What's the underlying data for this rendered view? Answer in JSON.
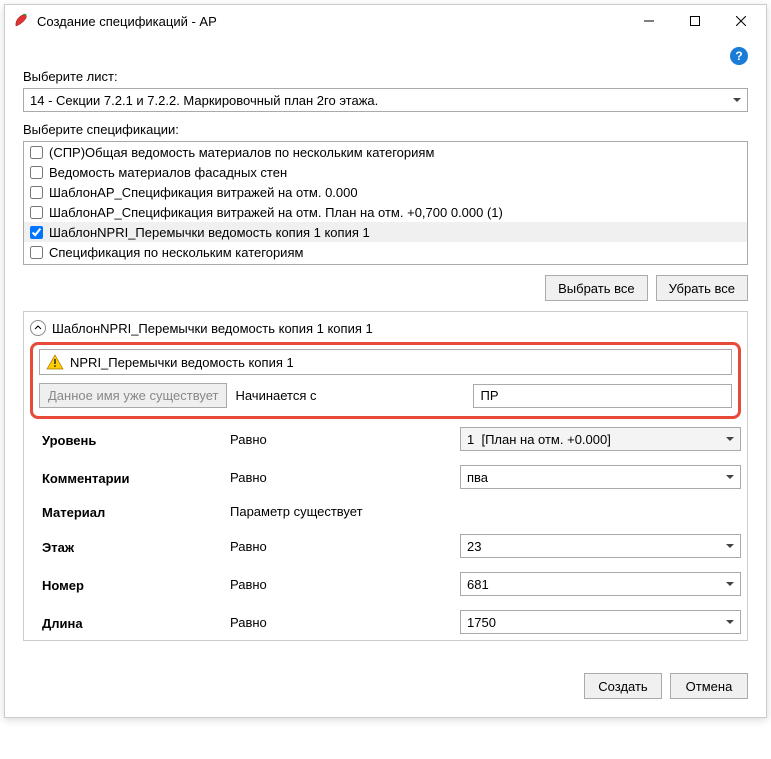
{
  "window": {
    "title": "Создание спецификаций - АР"
  },
  "help": "?",
  "sheet": {
    "label": "Выберите лист:",
    "value": "14 - Секции 7.2.1 и 7.2.2. Маркировочный план 2го этажа."
  },
  "specs": {
    "label": "Выберите спецификации:",
    "items": [
      {
        "label": "(СПР)Общая ведомость материалов по нескольким категориям",
        "checked": false,
        "sel": false
      },
      {
        "label": "Ведомость материалов фасадных стен",
        "checked": false,
        "sel": false
      },
      {
        "label": "ШаблонАР_Спецификация витражей на отм. 0.000",
        "checked": false,
        "sel": false
      },
      {
        "label": "ШаблонАР_Спецификация витражей на отм. План на отм. +0,700 0.000 (1)",
        "checked": false,
        "sel": false
      },
      {
        "label": "ШаблонNPRI_Перемычки ведомость копия 1 копия 1",
        "checked": true,
        "sel": true
      },
      {
        "label": "Спецификация по нескольким категориям",
        "checked": false,
        "sel": false
      }
    ],
    "select_all": "Выбрать все",
    "deselect_all": "Убрать все"
  },
  "group": {
    "header": "ШаблонNPRI_Перемычки ведомость копия 1 копия 1",
    "name_value": "NPRI_Перемычки ведомость копия 1",
    "exists_msg": "Данное имя уже существует",
    "starts_with_label": "Начинается с",
    "starts_with_value": "ПР",
    "params": [
      {
        "name": "Уровень",
        "cond": "Равно",
        "value": "1  [План на отм. +0.000]",
        "dd": true,
        "ro": true
      },
      {
        "name": "Комментарии",
        "cond": "Равно",
        "value": "пва",
        "dd": true,
        "ro": false
      },
      {
        "name": "Материал",
        "cond": "Параметр существует",
        "value": null,
        "dd": false,
        "ro": false
      },
      {
        "name": "Этаж",
        "cond": "Равно",
        "value": "23",
        "dd": true,
        "ro": false
      },
      {
        "name": "Номер",
        "cond": "Равно",
        "value": "681",
        "dd": true,
        "ro": false
      },
      {
        "name": "Длина",
        "cond": "Равно",
        "value": "1750",
        "dd": true,
        "ro": false
      }
    ]
  },
  "footer": {
    "create": "Создать",
    "cancel": "Отмена"
  }
}
